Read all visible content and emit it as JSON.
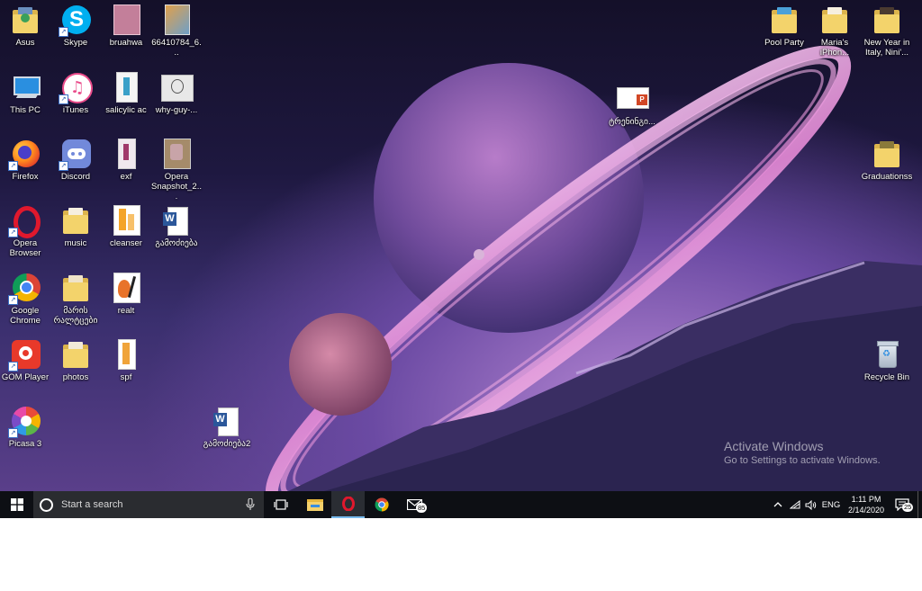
{
  "desktop": {
    "icons": [
      {
        "id": "asus",
        "label": "Asus",
        "kind": "folder",
        "photo": "#6a8fbf",
        "shortcut": false
      },
      {
        "id": "skype",
        "label": "Skype",
        "kind": "skype",
        "shortcut": true
      },
      {
        "id": "bruahwa",
        "label": "bruahwa",
        "kind": "image",
        "color": "#c37f9a"
      },
      {
        "id": "img66410784",
        "label": "66410784_6...",
        "kind": "image",
        "color": "#e0a04c"
      },
      {
        "id": "this-pc",
        "label": "This PC",
        "kind": "pc"
      },
      {
        "id": "itunes",
        "label": "iTunes",
        "kind": "itunes",
        "shortcut": true
      },
      {
        "id": "salicylic",
        "label": "salicylic ac",
        "kind": "image",
        "color": "#f5f5f5"
      },
      {
        "id": "why-guy",
        "label": "why-guy-...",
        "kind": "image",
        "color": "#e8e8e8"
      },
      {
        "id": "firefox",
        "label": "Firefox",
        "kind": "firefox",
        "shortcut": true
      },
      {
        "id": "discord",
        "label": "Discord",
        "kind": "discord",
        "shortcut": true
      },
      {
        "id": "exf",
        "label": "exf",
        "kind": "image",
        "color": "#f0e8ee"
      },
      {
        "id": "opera-snapshot",
        "label": "Opera Snapshot_2...",
        "kind": "image",
        "color": "#a58b6a"
      },
      {
        "id": "opera",
        "label": "Opera Browser",
        "kind": "opera",
        "shortcut": true
      },
      {
        "id": "music",
        "label": "music",
        "kind": "folder",
        "photo": "#f6efe0",
        "shortcut": false
      },
      {
        "id": "cleanser",
        "label": "cleanser",
        "kind": "image",
        "color": "#f4a428"
      },
      {
        "id": "gamotsveba",
        "label": "გამოძიება",
        "kind": "word"
      },
      {
        "id": "chrome",
        "label": "Google Chrome",
        "kind": "chrome",
        "shortcut": true
      },
      {
        "id": "maris-ralitsebi",
        "label": "მარის რალტცები",
        "kind": "folder",
        "photo": "#efe3c9",
        "shortcut": false
      },
      {
        "id": "realt",
        "label": "realt",
        "kind": "image",
        "color": "#e8732a"
      },
      {
        "id": "gom-player",
        "label": "GOM Player",
        "kind": "gom",
        "shortcut": true
      },
      {
        "id": "photos",
        "label": "photos",
        "kind": "folder",
        "photo": "#f2ead8",
        "shortcut": false
      },
      {
        "id": "spf",
        "label": "spf",
        "kind": "image",
        "color": "#f0a43a"
      },
      {
        "id": "picasa",
        "label": "Picasa 3",
        "kind": "picasa",
        "shortcut": true
      },
      {
        "id": "gamotsveba2",
        "label": "გამოძიება2",
        "kind": "word"
      },
      {
        "id": "treningi",
        "label": "ტრენინგი...",
        "kind": "ppt"
      },
      {
        "id": "pool-party",
        "label": "Pool Party",
        "kind": "folder",
        "photo": "#4aa0d8"
      },
      {
        "id": "marias-iphone",
        "label": "Maria's iPhon...",
        "kind": "folder",
        "photo": "#f6efe0"
      },
      {
        "id": "new-year-italy",
        "label": "New Year in Italy, Nini'...",
        "kind": "folder",
        "photo": "#4a3a30"
      },
      {
        "id": "graduationss",
        "label": "Graduationss",
        "kind": "folder",
        "photo": "#8a7a3a"
      },
      {
        "id": "recycle-bin",
        "label": "Recycle Bin",
        "kind": "recycle"
      }
    ]
  },
  "watermark": {
    "title": "Activate Windows",
    "subtitle": "Go to Settings to activate Windows."
  },
  "taskbar": {
    "search_placeholder": "Start a search",
    "mail_badge": "85",
    "language": "ENG",
    "time": "1:11 PM",
    "date": "2/14/2020",
    "notifications_count": "25"
  },
  "colors": {
    "taskbar_bg": "#0d0f14",
    "search_bg": "#2a2c30",
    "active_underline": "#76b9ed"
  }
}
